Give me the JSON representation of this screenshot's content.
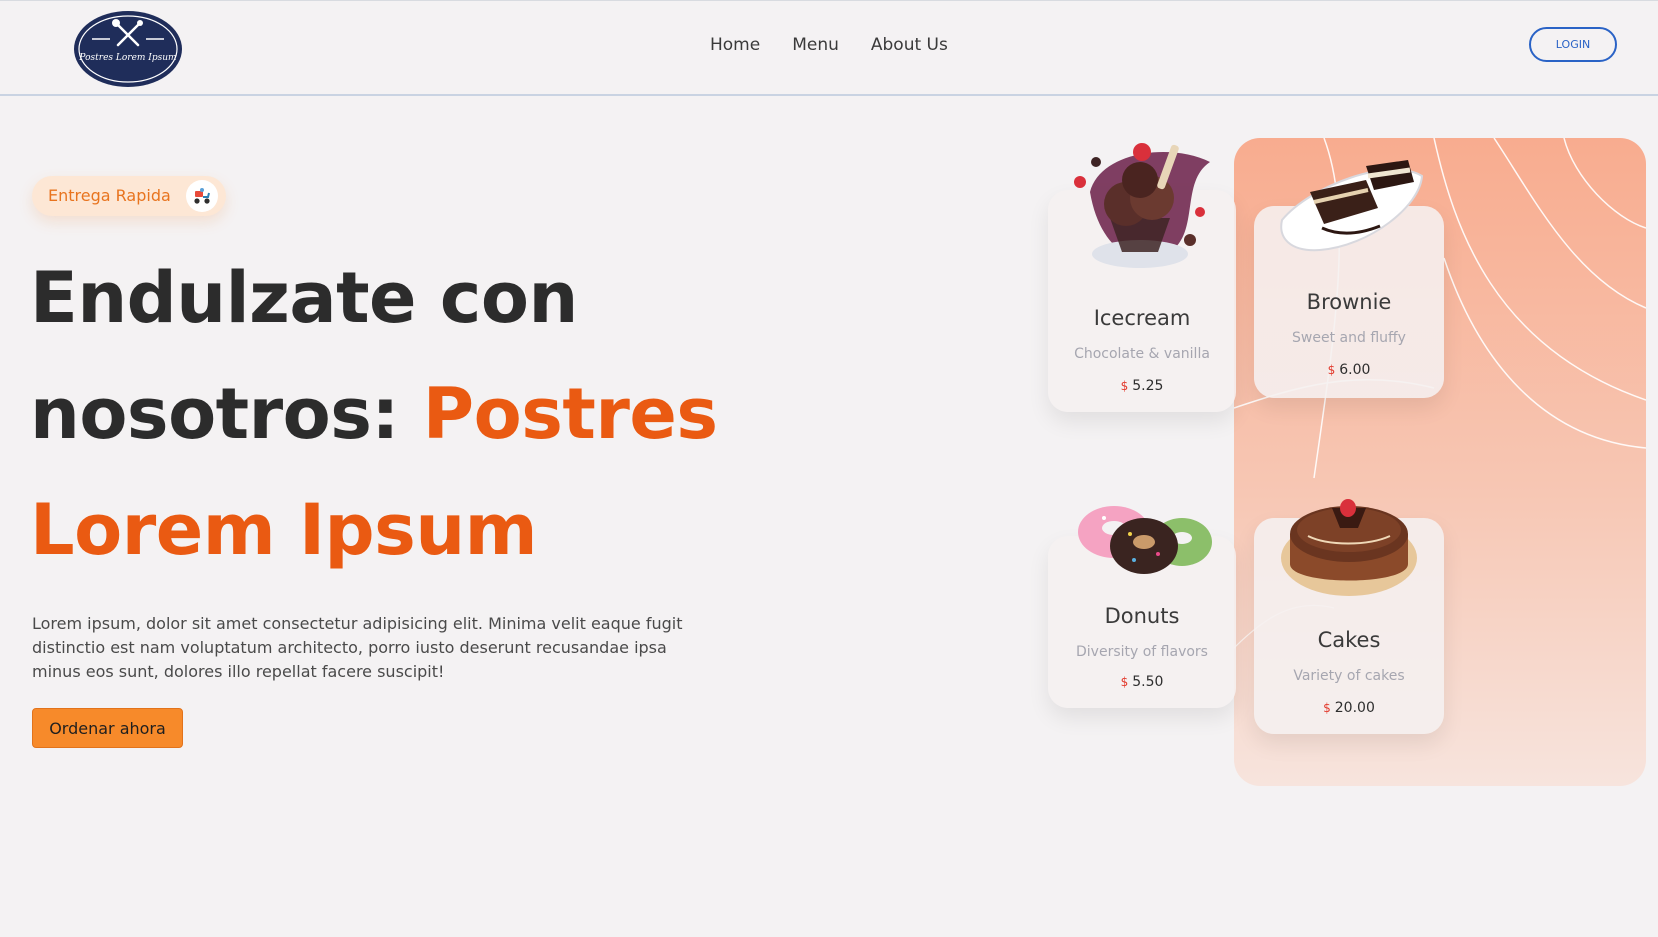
{
  "header": {
    "logo_text": "Postres Lorem Ipsum",
    "nav": [
      {
        "label": "Home"
      },
      {
        "label": "Menu"
      },
      {
        "label": "About Us"
      }
    ],
    "login_label": "LOGIN"
  },
  "hero": {
    "badge_label": "Entrega Rapida",
    "badge_icon": "delivery-scooter-icon",
    "headline_line1": "Endulzate con",
    "headline_line2_prefix": "nosotros: ",
    "headline_line2_accent": "Postres",
    "headline_line3_accent": "Lorem Ipsum",
    "description": "Lorem ipsum, dolor sit amet consectetur adipisicing elit. Minima velit eaque fugit distinctio est nam voluptatum architecto, porro iusto deserunt recusandae ipsa minus eos sunt, dolores illo repellat facere suscipit!",
    "cta_label": "Ordenar ahora"
  },
  "products": [
    {
      "name": "Icecream",
      "subtitle": "Chocolate & vanilla",
      "currency": "$",
      "price": "5.25"
    },
    {
      "name": "Brownie",
      "subtitle": "Sweet and fluffy",
      "currency": "$",
      "price": "6.00"
    },
    {
      "name": "Donuts",
      "subtitle": "Diversity of flavors",
      "currency": "$",
      "price": "5.50"
    },
    {
      "name": "Cakes",
      "subtitle": "Variety of cakes",
      "currency": "$",
      "price": "20.00"
    }
  ],
  "colors": {
    "accent": "#ea5a12",
    "button": "#f78a2a",
    "login": "#2a63c6",
    "logo": "#1f2d5a",
    "panel_top": "#f8ac8f",
    "price_currency": "#e23b2e"
  }
}
